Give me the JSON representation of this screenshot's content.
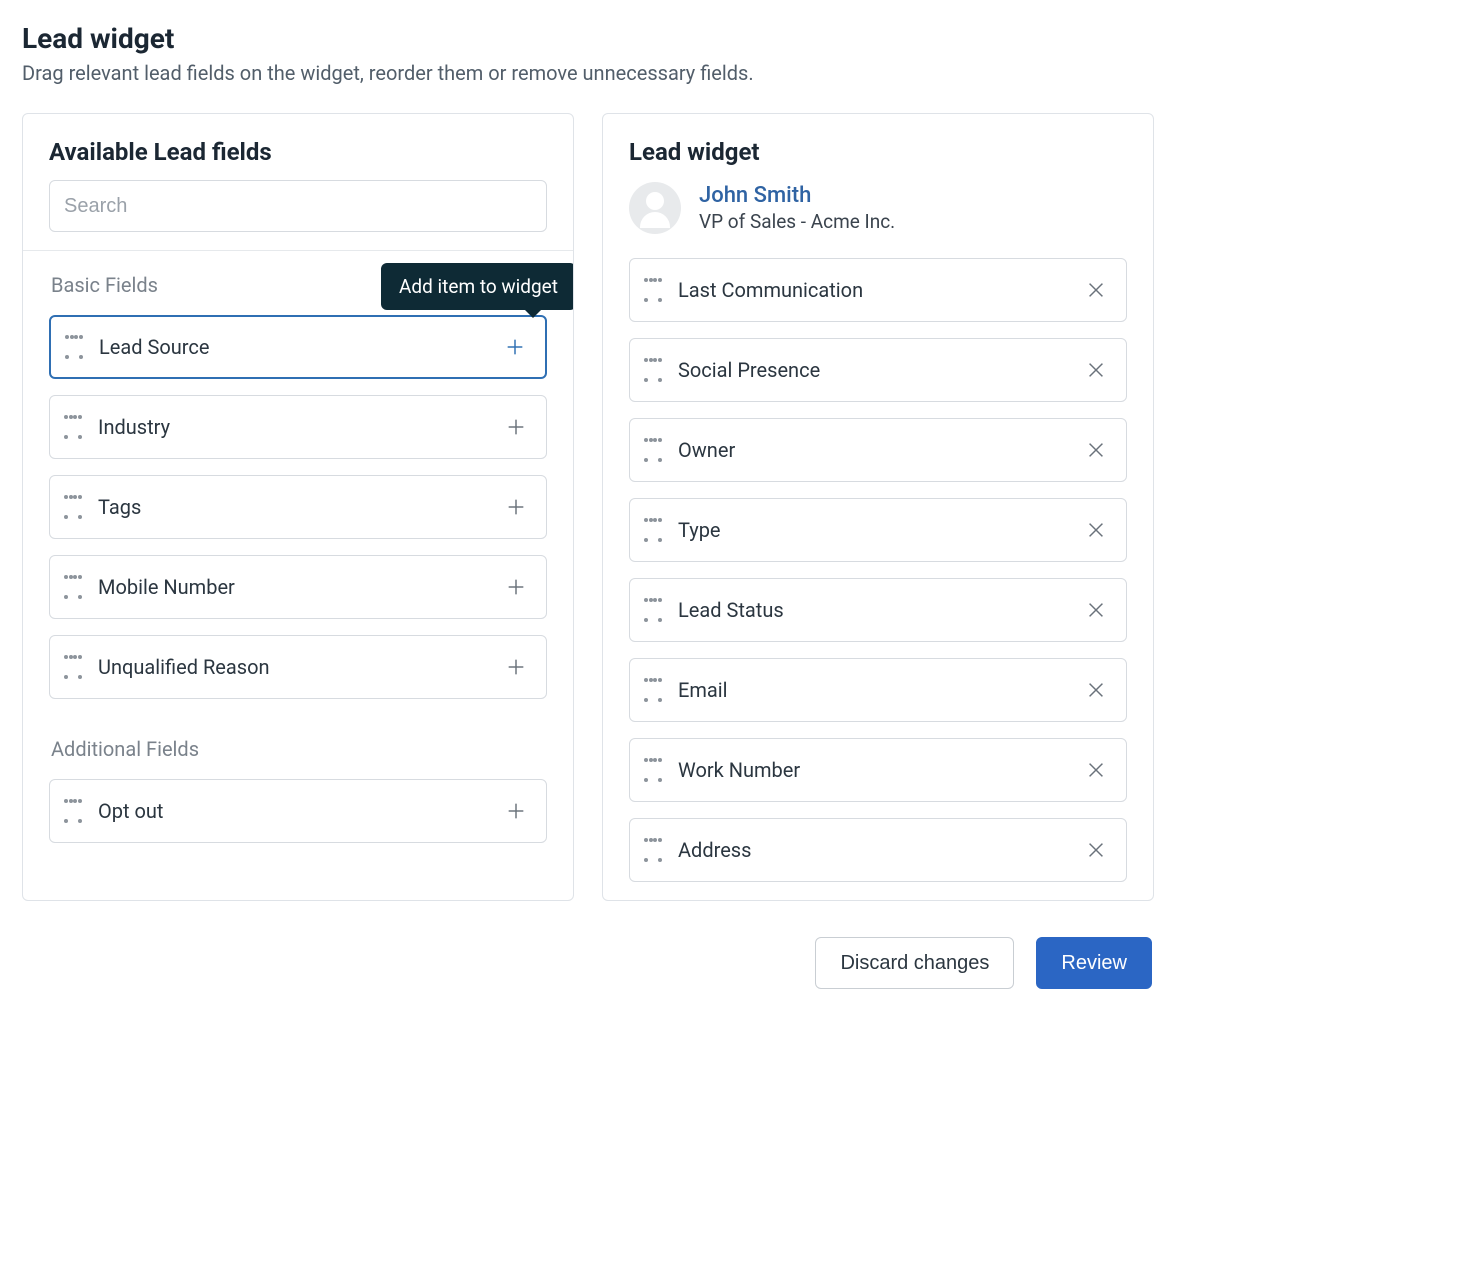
{
  "header": {
    "title": "Lead widget",
    "subtitle": "Drag relevant lead fields on the widget, reorder them or remove unnecessary fields."
  },
  "left_panel": {
    "title": "Available Lead fields",
    "search_placeholder": "Search",
    "groups": [
      {
        "label": "Basic Fields",
        "items": [
          {
            "label": "Lead Source",
            "highlight": true
          },
          {
            "label": "Industry"
          },
          {
            "label": "Tags"
          },
          {
            "label": "Mobile Number"
          },
          {
            "label": "Unqualified Reason"
          }
        ]
      },
      {
        "label": "Additional Fields",
        "items": [
          {
            "label": "Opt out"
          }
        ]
      }
    ],
    "tooltip": "Add item to widget"
  },
  "right_panel": {
    "title": "Lead widget",
    "lead": {
      "name": "John Smith",
      "subtitle": "VP of Sales - Acme Inc."
    },
    "items": [
      {
        "label": "Last Communication"
      },
      {
        "label": "Social Presence"
      },
      {
        "label": "Owner"
      },
      {
        "label": "Type"
      },
      {
        "label": "Lead Status"
      },
      {
        "label": "Email"
      },
      {
        "label": "Work Number"
      },
      {
        "label": "Address"
      }
    ]
  },
  "footer": {
    "discard": "Discard changes",
    "review": "Review"
  }
}
